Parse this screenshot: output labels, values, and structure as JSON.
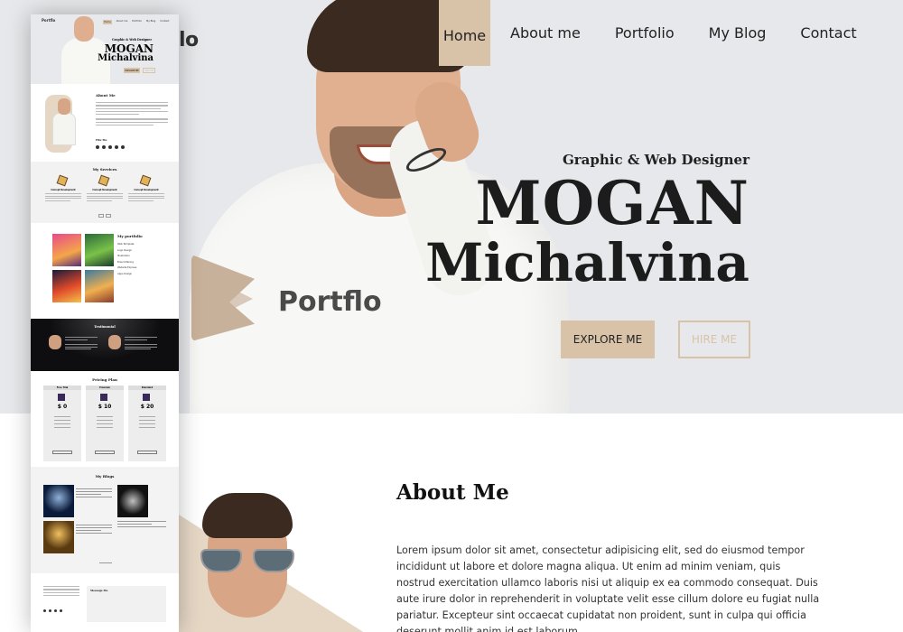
{
  "hero": {
    "partial_logo": "lo",
    "nav": [
      {
        "label": "Home",
        "active": true
      },
      {
        "label": "About me",
        "active": false
      },
      {
        "label": "Portfolio",
        "active": false
      },
      {
        "label": "My Blog",
        "active": false
      },
      {
        "label": "Contact",
        "active": false
      }
    ],
    "subtitle": "Graphic & Web Designer",
    "name_line1": "MOGAN",
    "name_line2": "Michalvina",
    "explore_label": "EXPLORE ME",
    "hire_label": "HIRE ME",
    "brand_name": "Portflo"
  },
  "about": {
    "title": "About Me",
    "text": "Lorem ipsum dolor sit amet, consectetur adipisicing elit, sed do eiusmod tempor incididunt ut labore et dolore magna aliqua. Ut enim ad minim veniam, quis nostrud exercitation ullamco laboris nisi ut aliquip ex ea commodo consequat. Duis aute irure dolor in reprehenderit in voluptate velit esse cillum dolore eu fugiat nulla pariatur. Excepteur sint occaecat cupidatat non proident, sunt in culpa qui officia deserunt mollit anim id est laborum."
  },
  "mini": {
    "logo": "Portflo",
    "nav": [
      "Home",
      "About me",
      "Portfolio",
      "My Blog",
      "Contact"
    ],
    "subtitle": "Graphic & Web Designer",
    "name_line1": "MOGAN",
    "name_line2": "Michalvina",
    "explore_label": "EXPLORE ME",
    "hire_label": "HIRE ME",
    "about_title": "About Me",
    "follow_label": "Fllw Me",
    "services_title": "My Services",
    "services": [
      "Concept Development",
      "Concept Development",
      "Concept Development"
    ],
    "portfolio_title": "My portfolio",
    "portfolio_list": [
      "Web Template",
      "Logo Design",
      "Illustration",
      "Brand Making",
      "Website Express",
      "Apps Design"
    ],
    "testimonial_title": "Testimonial",
    "pricing_title": "Pricing Plan",
    "plans": [
      {
        "name": "Free Trial",
        "price": "$ 0"
      },
      {
        "name": "Premium",
        "price": "$ 10"
      },
      {
        "name": "Standard",
        "price": "$ 20"
      }
    ],
    "blogs_title": "My Blogs",
    "message_title": "Message Me"
  },
  "colors": {
    "accent": "#d9c3a8",
    "hero_bg": "#e6e8eb",
    "text_dark": "#1c1c1c",
    "testimonial_bg": "#0e0e10"
  }
}
